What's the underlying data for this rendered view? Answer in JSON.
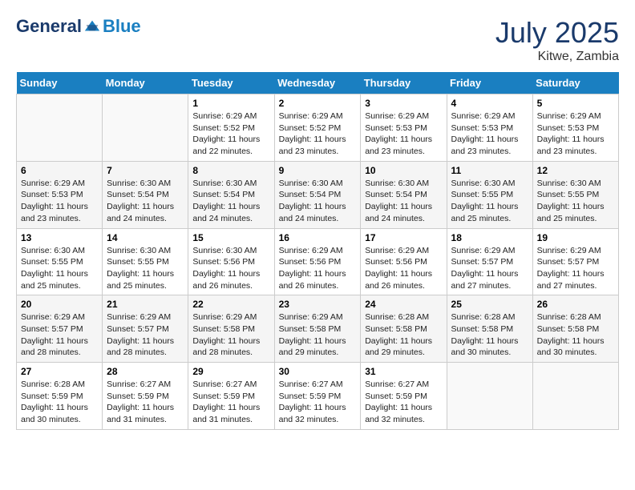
{
  "header": {
    "logo": {
      "general": "General",
      "blue": "Blue"
    },
    "title": "July 2025",
    "location": "Kitwe, Zambia"
  },
  "calendar": {
    "days_of_week": [
      "Sunday",
      "Monday",
      "Tuesday",
      "Wednesday",
      "Thursday",
      "Friday",
      "Saturday"
    ],
    "weeks": [
      [
        {
          "day": "",
          "info": ""
        },
        {
          "day": "",
          "info": ""
        },
        {
          "day": "1",
          "info": "Sunrise: 6:29 AM\nSunset: 5:52 PM\nDaylight: 11 hours and 22 minutes."
        },
        {
          "day": "2",
          "info": "Sunrise: 6:29 AM\nSunset: 5:52 PM\nDaylight: 11 hours and 23 minutes."
        },
        {
          "day": "3",
          "info": "Sunrise: 6:29 AM\nSunset: 5:53 PM\nDaylight: 11 hours and 23 minutes."
        },
        {
          "day": "4",
          "info": "Sunrise: 6:29 AM\nSunset: 5:53 PM\nDaylight: 11 hours and 23 minutes."
        },
        {
          "day": "5",
          "info": "Sunrise: 6:29 AM\nSunset: 5:53 PM\nDaylight: 11 hours and 23 minutes."
        }
      ],
      [
        {
          "day": "6",
          "info": "Sunrise: 6:29 AM\nSunset: 5:53 PM\nDaylight: 11 hours and 23 minutes."
        },
        {
          "day": "7",
          "info": "Sunrise: 6:30 AM\nSunset: 5:54 PM\nDaylight: 11 hours and 24 minutes."
        },
        {
          "day": "8",
          "info": "Sunrise: 6:30 AM\nSunset: 5:54 PM\nDaylight: 11 hours and 24 minutes."
        },
        {
          "day": "9",
          "info": "Sunrise: 6:30 AM\nSunset: 5:54 PM\nDaylight: 11 hours and 24 minutes."
        },
        {
          "day": "10",
          "info": "Sunrise: 6:30 AM\nSunset: 5:54 PM\nDaylight: 11 hours and 24 minutes."
        },
        {
          "day": "11",
          "info": "Sunrise: 6:30 AM\nSunset: 5:55 PM\nDaylight: 11 hours and 25 minutes."
        },
        {
          "day": "12",
          "info": "Sunrise: 6:30 AM\nSunset: 5:55 PM\nDaylight: 11 hours and 25 minutes."
        }
      ],
      [
        {
          "day": "13",
          "info": "Sunrise: 6:30 AM\nSunset: 5:55 PM\nDaylight: 11 hours and 25 minutes."
        },
        {
          "day": "14",
          "info": "Sunrise: 6:30 AM\nSunset: 5:55 PM\nDaylight: 11 hours and 25 minutes."
        },
        {
          "day": "15",
          "info": "Sunrise: 6:30 AM\nSunset: 5:56 PM\nDaylight: 11 hours and 26 minutes."
        },
        {
          "day": "16",
          "info": "Sunrise: 6:29 AM\nSunset: 5:56 PM\nDaylight: 11 hours and 26 minutes."
        },
        {
          "day": "17",
          "info": "Sunrise: 6:29 AM\nSunset: 5:56 PM\nDaylight: 11 hours and 26 minutes."
        },
        {
          "day": "18",
          "info": "Sunrise: 6:29 AM\nSunset: 5:57 PM\nDaylight: 11 hours and 27 minutes."
        },
        {
          "day": "19",
          "info": "Sunrise: 6:29 AM\nSunset: 5:57 PM\nDaylight: 11 hours and 27 minutes."
        }
      ],
      [
        {
          "day": "20",
          "info": "Sunrise: 6:29 AM\nSunset: 5:57 PM\nDaylight: 11 hours and 28 minutes."
        },
        {
          "day": "21",
          "info": "Sunrise: 6:29 AM\nSunset: 5:57 PM\nDaylight: 11 hours and 28 minutes."
        },
        {
          "day": "22",
          "info": "Sunrise: 6:29 AM\nSunset: 5:58 PM\nDaylight: 11 hours and 28 minutes."
        },
        {
          "day": "23",
          "info": "Sunrise: 6:29 AM\nSunset: 5:58 PM\nDaylight: 11 hours and 29 minutes."
        },
        {
          "day": "24",
          "info": "Sunrise: 6:28 AM\nSunset: 5:58 PM\nDaylight: 11 hours and 29 minutes."
        },
        {
          "day": "25",
          "info": "Sunrise: 6:28 AM\nSunset: 5:58 PM\nDaylight: 11 hours and 30 minutes."
        },
        {
          "day": "26",
          "info": "Sunrise: 6:28 AM\nSunset: 5:58 PM\nDaylight: 11 hours and 30 minutes."
        }
      ],
      [
        {
          "day": "27",
          "info": "Sunrise: 6:28 AM\nSunset: 5:59 PM\nDaylight: 11 hours and 30 minutes."
        },
        {
          "day": "28",
          "info": "Sunrise: 6:27 AM\nSunset: 5:59 PM\nDaylight: 11 hours and 31 minutes."
        },
        {
          "day": "29",
          "info": "Sunrise: 6:27 AM\nSunset: 5:59 PM\nDaylight: 11 hours and 31 minutes."
        },
        {
          "day": "30",
          "info": "Sunrise: 6:27 AM\nSunset: 5:59 PM\nDaylight: 11 hours and 32 minutes."
        },
        {
          "day": "31",
          "info": "Sunrise: 6:27 AM\nSunset: 5:59 PM\nDaylight: 11 hours and 32 minutes."
        },
        {
          "day": "",
          "info": ""
        },
        {
          "day": "",
          "info": ""
        }
      ]
    ]
  }
}
